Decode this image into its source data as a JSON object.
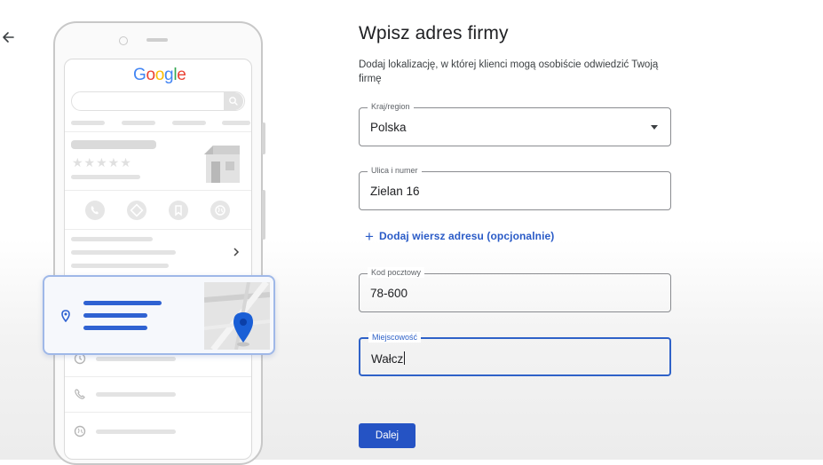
{
  "brand": {
    "google_letters": [
      {
        "ch": "G",
        "color": "#4285F4"
      },
      {
        "ch": "o",
        "color": "#EA4335"
      },
      {
        "ch": "o",
        "color": "#FBBC05"
      },
      {
        "ch": "g",
        "color": "#4285F4"
      },
      {
        "ch": "l",
        "color": "#34A853"
      },
      {
        "ch": "e",
        "color": "#EA4335"
      }
    ],
    "stars": "★★★★★"
  },
  "form": {
    "title": "Wpisz adres firmy",
    "subtitle": "Dodaj lokalizację, w której klienci mogą osobiście odwiedzić Twoją firmę",
    "country": {
      "label": "Kraj/region",
      "value": "Polska"
    },
    "street": {
      "label": "Ulica i numer",
      "value": "Zielan 16"
    },
    "add_line": "Dodaj wiersz adresu (opcjonalnie)",
    "postal": {
      "label": "Kod pocztowy",
      "value": "78-600"
    },
    "city": {
      "label": "Miejscowość",
      "value": "Wałcz"
    },
    "next_label": "Dalej"
  },
  "colors": {
    "accent": "#2553c4",
    "link": "#2a5bc7",
    "pin": "#1a5fd6"
  }
}
